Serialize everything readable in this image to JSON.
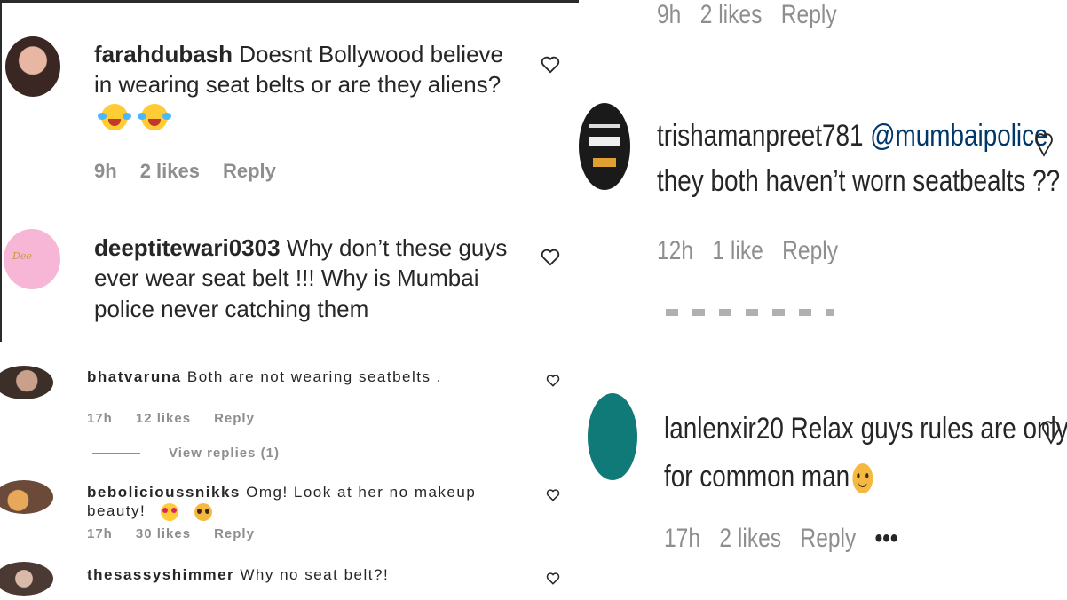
{
  "comments_left_large": [
    {
      "username": "farahdubash",
      "text": " Doesnt Bollywood believe in wearing seat belts or are they aliens?",
      "emojis": [
        "laughing-tears",
        "laughing-tears"
      ],
      "time": "9h",
      "likes": "2 likes",
      "reply": "Reply"
    },
    {
      "username": "deeptitewari0303",
      "text": " Why don’t these guys ever wear seat belt !!! Why is Mumbai police never catching them"
    }
  ],
  "comments_left_small": [
    {
      "username": "bhatvaruna",
      "text": " Both are not wearing seatbelts .",
      "time": "17h",
      "likes": "12 likes",
      "reply": "Reply",
      "view_replies": "View replies (1)"
    },
    {
      "username": "bebolicioussnikks",
      "text": " Omg! Look at her no makeup beauty!",
      "emojis": [
        "heart-eyes",
        "pleading"
      ],
      "time": "17h",
      "likes": "30 likes",
      "reply": "Reply"
    },
    {
      "username": "thesassyshimmer",
      "text": " Why no seat belt?!"
    }
  ],
  "comments_right": [
    {
      "time": "9h",
      "likes": "2 likes",
      "reply": "Reply"
    },
    {
      "username": "trishamanpreet781",
      "mention": "@mumbaipolice",
      "text": "they both haven’t worn seatbealts ??",
      "time": "12h",
      "likes": "1 like",
      "reply": "Reply"
    },
    {
      "username": "lanlenxir20",
      "text": " Relax guys rules are only for common man",
      "emojis": [
        "smiling"
      ],
      "time": "17h",
      "likes": "2 likes",
      "reply": "Reply",
      "more": "•••"
    }
  ],
  "colors": {
    "meta": "#8e8e8e",
    "text": "#262626",
    "mention": "#00376b",
    "teal_avatar": "#0f7a78"
  }
}
